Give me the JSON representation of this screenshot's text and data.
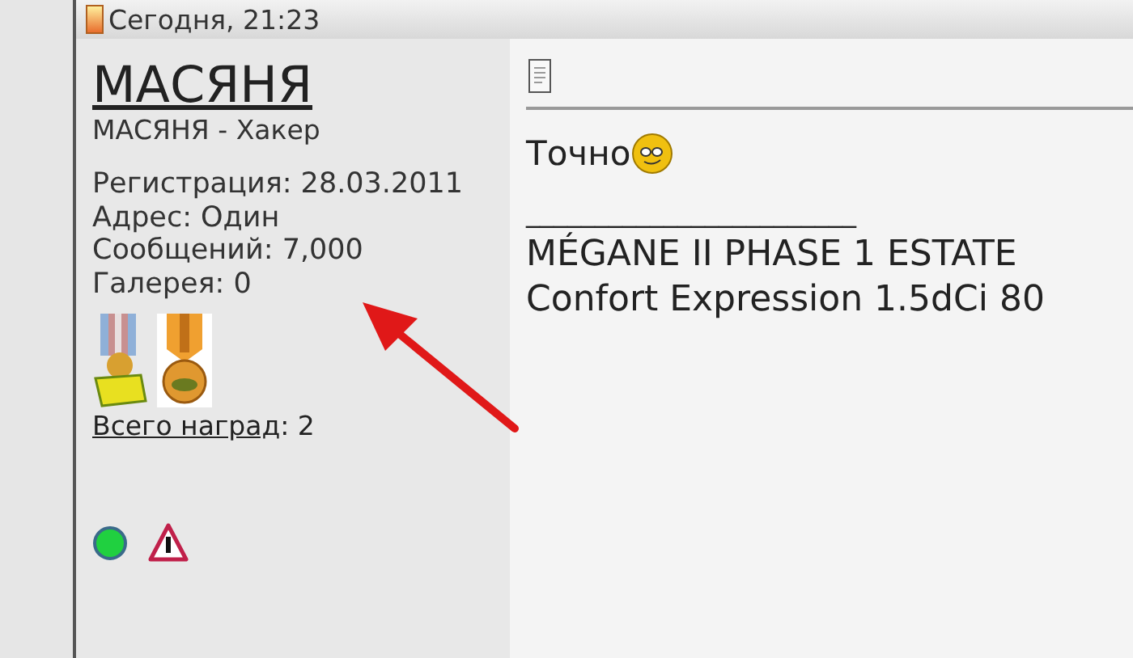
{
  "post_header": {
    "date": "Сегодня, 21:23"
  },
  "author": {
    "name": "МАСЯНЯ",
    "title": "МАСЯНЯ - Хакер",
    "details": [
      {
        "label": "Регистрация:",
        "value": "28.03.2011"
      },
      {
        "label": "Адрес:",
        "value": "Один"
      },
      {
        "label": "Сообщений:",
        "value": "7,000"
      },
      {
        "label": "Галерея:",
        "value": "0"
      }
    ],
    "awards_link": "Всего наград",
    "awards_count": ": 2",
    "online": true
  },
  "post": {
    "text": "Точно",
    "signature_rule": "________________________",
    "signature": [
      "MÉGANE II PHASE 1 ESTATE",
      "Confort Expression 1.5dCi 80"
    ]
  }
}
